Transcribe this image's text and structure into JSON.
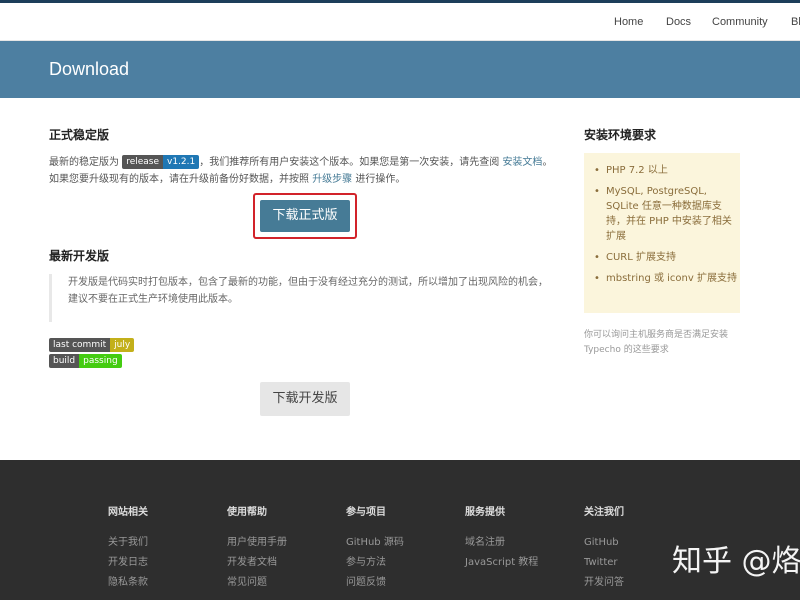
{
  "nav": {
    "home": "Home",
    "docs": "Docs",
    "community": "Community",
    "blog": "Bl"
  },
  "banner": {
    "title": "Download"
  },
  "stable": {
    "title": "正式稳定版",
    "text_before": "最新的稳定版为 ",
    "badge_left": "release",
    "badge_right": "v1.2.1",
    "text_after": "，我们推荐所有用户安装这个版本。如果您是第一次安装，请先查阅 ",
    "install_doc_link": "安装文档",
    "text_end": "。",
    "line2_before": "如果您要升级现有的版本，请在升级前备份好数据，并按照 ",
    "upgrade_link": "升级步骤",
    "line2_after": " 进行操作。",
    "download_button": "下载正式版"
  },
  "dev": {
    "title": "最新开发版",
    "quote": "开发版是代码实时打包版本，包含了最新的功能，但由于没有经过充分的测试，所以增加了出现风险的机会，建议不要在正式生产环境使用此版本。",
    "badge1_left": "last commit",
    "badge1_right": "july",
    "badge2_left": "build",
    "badge2_right": "passing",
    "download_button": "下载开发版"
  },
  "requirements": {
    "title": "安装环境要求",
    "items": [
      "PHP 7.2 以上",
      "MySQL, PostgreSQL, SQLite 任意一种数据库支持，并在 PHP 中安装了相关扩展",
      "CURL 扩展支持",
      "mbstring 或 iconv 扩展支持"
    ],
    "note": "你可以询问主机服务商是否满足安装 Typecho 的这些要求"
  },
  "footer": {
    "columns": [
      {
        "title": "网站相关",
        "items": [
          "关于我们",
          "开发日志",
          "隐私条款"
        ]
      },
      {
        "title": "使用帮助",
        "items": [
          "用户使用手册",
          "开发者文档",
          "常见问题"
        ]
      },
      {
        "title": "参与项目",
        "items": [
          "GitHub 源码",
          "参与方法",
          "问题反馈"
        ]
      },
      {
        "title": "服务提供",
        "items": [
          "域名注册",
          "JavaScript 教程"
        ]
      },
      {
        "title": "关注我们",
        "items": [
          "GitHub",
          "Twitter",
          "开发问答"
        ]
      }
    ],
    "watermark": "知乎 @烙"
  },
  "colors": {
    "accent": "#467b96",
    "banner": "#4d7fa1",
    "highlight_border": "#d2232a",
    "footer_bg": "#2e2e2e",
    "badge_commit": "#c3b01a",
    "badge_passing": "#4c1"
  }
}
